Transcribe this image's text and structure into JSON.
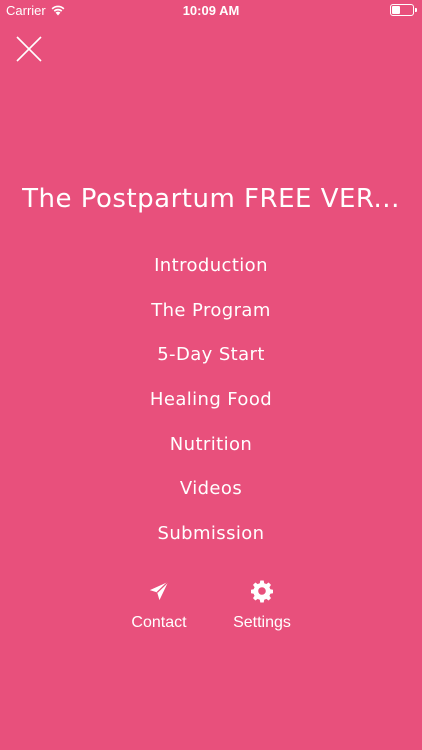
{
  "status_bar": {
    "carrier": "Carrier",
    "time": "10:09 AM"
  },
  "title": "The Postpartum FREE VER...",
  "menu": [
    "Introduction",
    "The Program",
    "5-Day Start",
    "Healing Food",
    "Nutrition",
    "Videos",
    "Submission"
  ],
  "actions": {
    "contact": {
      "label": "Contact",
      "icon": "paper-plane-icon"
    },
    "settings": {
      "label": "Settings",
      "icon": "gear-icon"
    }
  },
  "colors": {
    "background": "#E8507C",
    "foreground": "#FFFFFF"
  }
}
